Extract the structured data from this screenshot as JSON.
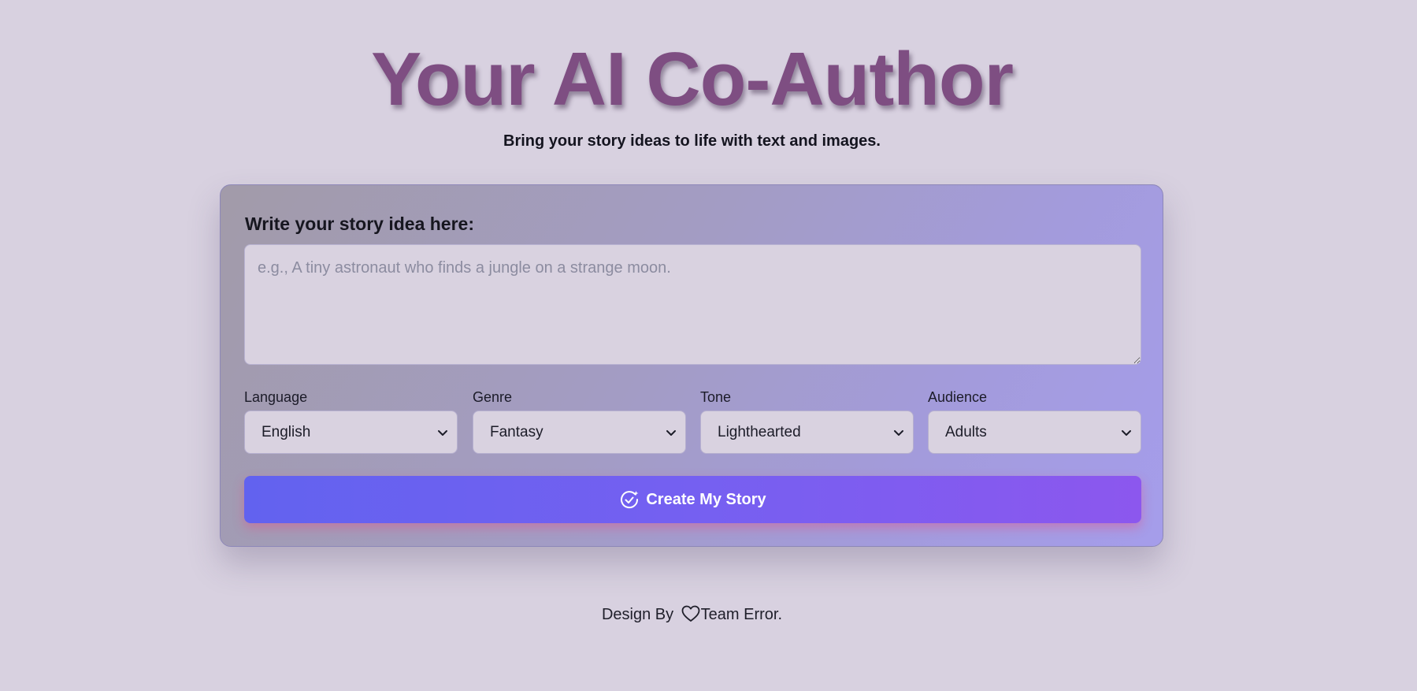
{
  "header": {
    "title": "Your AI Co-Author",
    "subtitle": "Bring your story ideas to life with text and images."
  },
  "form": {
    "idea_label": "Write your story idea here:",
    "idea_placeholder": "e.g., A tiny astronaut who finds a jungle on a strange moon.",
    "idea_value": "",
    "fields": [
      {
        "label": "Language",
        "value": "English",
        "icon": "chevron-down-icon"
      },
      {
        "label": "Genre",
        "value": "Fantasy",
        "icon": "chevron-down-icon"
      },
      {
        "label": "Tone",
        "value": "Lighthearted",
        "icon": "chevron-down-icon"
      },
      {
        "label": "Audience",
        "value": "Adults",
        "icon": "chevron-down-icon"
      }
    ],
    "submit_label": "Create My Story",
    "submit_icon": "sparkle-check-icon"
  },
  "footer": {
    "prefix": "Design By",
    "icon": "heart-icon",
    "team": "Team Error."
  },
  "colors": {
    "background": "#d8d1e0",
    "title": "#7e4e82",
    "button_start": "#6262ef",
    "button_end": "#8c57ee",
    "button_glow": "#e1508c"
  }
}
